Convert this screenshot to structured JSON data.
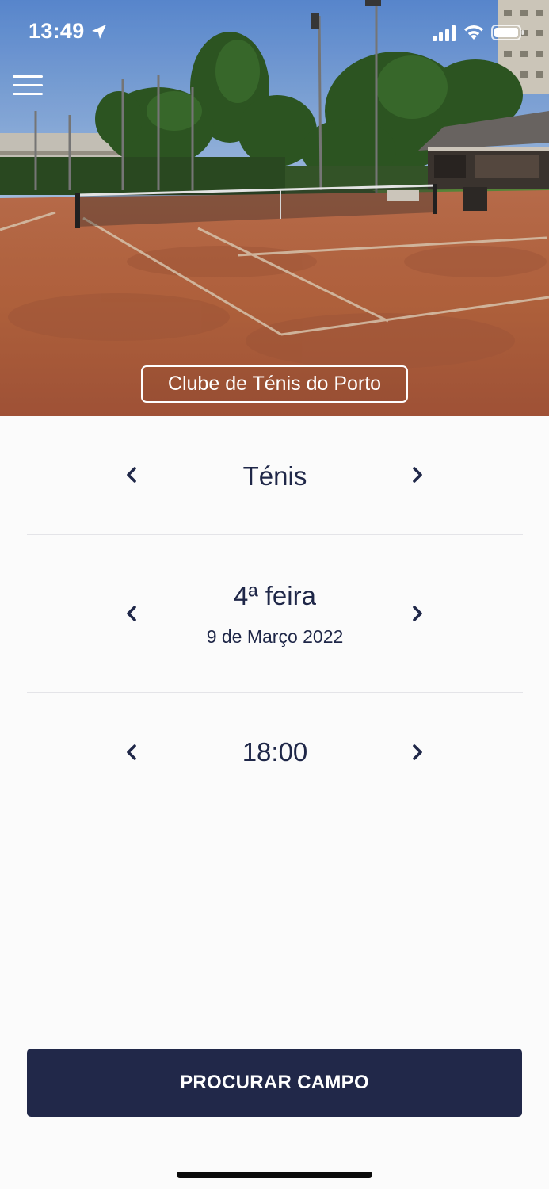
{
  "status_bar": {
    "time": "13:49",
    "icons": [
      "location-arrow-icon",
      "cellular-signal-icon",
      "wifi-icon",
      "battery-icon"
    ]
  },
  "header": {
    "menu_icon": "hamburger-menu-icon",
    "club_name": "Clube de Ténis do Porto",
    "hero_image": "tennis clay court photo"
  },
  "selectors": {
    "sport": {
      "value": "Ténis"
    },
    "date": {
      "weekday": "4ª feira",
      "full_date": "9 de Março 2022"
    },
    "time": {
      "value": "18:00"
    },
    "prev_icon": "chevron-left-icon",
    "next_icon": "chevron-right-icon"
  },
  "actions": {
    "search_label": "PROCURAR CAMPO"
  },
  "colors": {
    "primary": "#212849",
    "text": "#1f2748",
    "background": "#fbfbfb",
    "divider": "#e4e4e8",
    "clay": "#c06a45"
  }
}
